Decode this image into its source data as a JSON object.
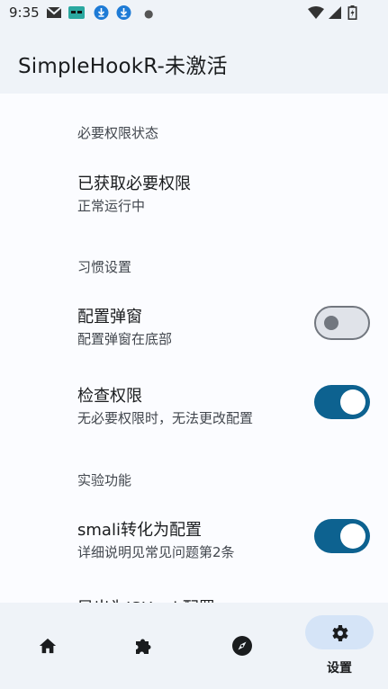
{
  "status_bar": {
    "time": "9:35",
    "icons": [
      "gmail-icon",
      "app-icon",
      "download-icon",
      "download-icon",
      "wifi-icon",
      "signal-icon",
      "battery-icon"
    ]
  },
  "app_bar": {
    "title": "SimpleHookR-未激活"
  },
  "sections": {
    "permission": {
      "header": "必要权限状态"
    },
    "habits": {
      "header": "习惯设置"
    },
    "experimental": {
      "header": "实验功能"
    }
  },
  "prefs": {
    "permission_status": {
      "title": "已获取必要权限",
      "summary": "正常运行中"
    },
    "config_popup": {
      "title": "配置弹窗",
      "summary": "配置弹窗在底部",
      "checked": false
    },
    "check_permission": {
      "title": "检查权限",
      "summary": "无必要权限时，无法更改配置",
      "checked": true
    },
    "smali_convert": {
      "title": "smali转化为配置",
      "summary": "详细说明见常见问题第2条",
      "checked": true
    },
    "export_partial": {
      "title": "导出为JSHook配置"
    }
  },
  "bottom_nav": {
    "items": [
      {
        "icon": "home-icon",
        "selected": false
      },
      {
        "icon": "extension-icon",
        "selected": false
      },
      {
        "icon": "compass-icon",
        "selected": false
      },
      {
        "icon": "settings-icon",
        "label": "设置",
        "selected": true
      }
    ]
  },
  "colors": {
    "accent": "#0d6290",
    "surface": "#fbfcff",
    "bar": "#eff3f8",
    "nav_pill": "#d5e4f7"
  }
}
